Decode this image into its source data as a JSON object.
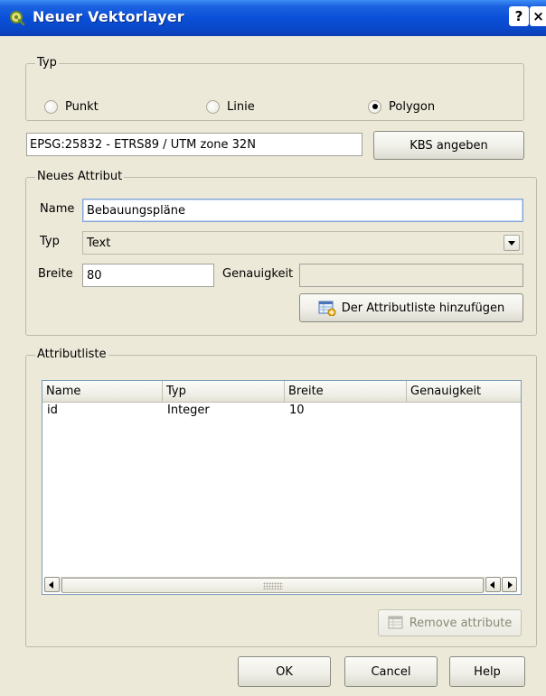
{
  "window": {
    "title": "Neuer Vektorlayer",
    "help_button": "?",
    "close_button": "×"
  },
  "type_group": {
    "title": "Typ",
    "options": [
      {
        "label": "Punkt",
        "checked": false
      },
      {
        "label": "Linie",
        "checked": false
      },
      {
        "label": "Polygon",
        "checked": true
      }
    ]
  },
  "crs": {
    "value": "EPSG:25832 - ETRS89 / UTM zone 32N",
    "button_label": "KBS angeben"
  },
  "new_attribute": {
    "title": "Neues Attribut",
    "name_label": "Name",
    "name_value": "Bebauungspläne",
    "type_label": "Typ",
    "type_value": "Text",
    "width_label": "Breite",
    "width_value": "80",
    "precision_label": "Genauigkeit",
    "precision_value": "",
    "add_button_label": "Der Attributliste hinzufügen"
  },
  "attribute_list": {
    "title": "Attributliste",
    "columns": [
      "Name",
      "Typ",
      "Breite",
      "Genauigkeit"
    ],
    "rows": [
      [
        "id",
        "Integer",
        "10",
        ""
      ]
    ],
    "remove_button_label": "Remove attribute"
  },
  "footer": {
    "ok_label": "OK",
    "cancel_label": "Cancel",
    "help_label": "Help"
  }
}
